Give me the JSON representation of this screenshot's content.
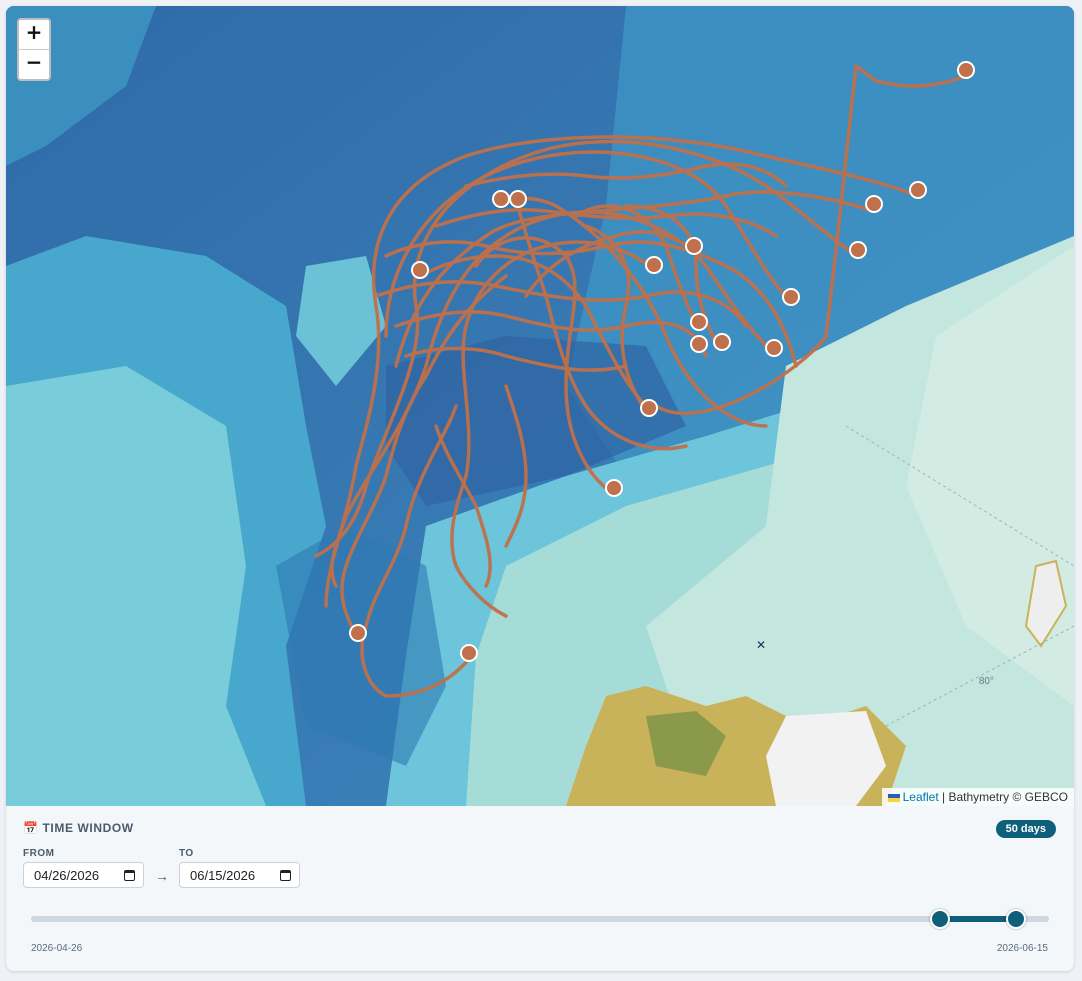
{
  "map": {
    "zoom_in_label": "+",
    "zoom_out_label": "−",
    "attribution_link": "Leaflet",
    "attribution_text": "| Bathymetry © GEBCO",
    "grid_label": "80°",
    "track_color": "#c0704a",
    "marker_fill": "#c0704a",
    "marker_stroke": "#ffffff"
  },
  "time_window": {
    "title": "TIME WINDOW",
    "title_icon": "calendar-icon",
    "days_badge": "50 days",
    "from_label": "FROM",
    "to_label": "TO",
    "from_value": "04/26/2026",
    "to_value": "06/15/2026",
    "arrow": "→",
    "range_start_label": "2026-04-26",
    "range_end_label": "2026-06-15",
    "slider_start_fraction": 0.89,
    "slider_end_fraction": 0.965,
    "accent_color": "#0e5f7a"
  }
}
